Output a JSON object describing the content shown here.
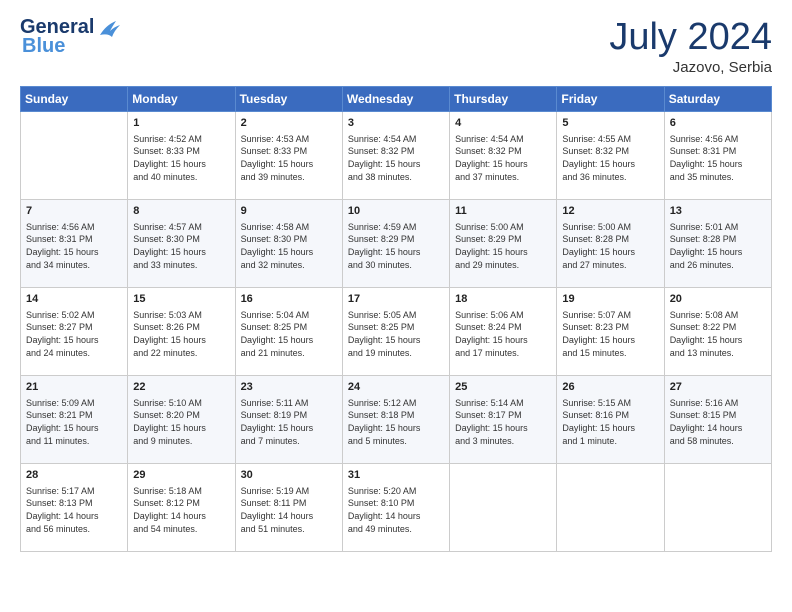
{
  "header": {
    "logo_line1": "General",
    "logo_line2": "Blue",
    "title": "July 2024",
    "location": "Jazovo, Serbia"
  },
  "weekdays": [
    "Sunday",
    "Monday",
    "Tuesday",
    "Wednesday",
    "Thursday",
    "Friday",
    "Saturday"
  ],
  "weeks": [
    [
      {
        "day": "",
        "info": ""
      },
      {
        "day": "1",
        "info": "Sunrise: 4:52 AM\nSunset: 8:33 PM\nDaylight: 15 hours\nand 40 minutes."
      },
      {
        "day": "2",
        "info": "Sunrise: 4:53 AM\nSunset: 8:33 PM\nDaylight: 15 hours\nand 39 minutes."
      },
      {
        "day": "3",
        "info": "Sunrise: 4:54 AM\nSunset: 8:32 PM\nDaylight: 15 hours\nand 38 minutes."
      },
      {
        "day": "4",
        "info": "Sunrise: 4:54 AM\nSunset: 8:32 PM\nDaylight: 15 hours\nand 37 minutes."
      },
      {
        "day": "5",
        "info": "Sunrise: 4:55 AM\nSunset: 8:32 PM\nDaylight: 15 hours\nand 36 minutes."
      },
      {
        "day": "6",
        "info": "Sunrise: 4:56 AM\nSunset: 8:31 PM\nDaylight: 15 hours\nand 35 minutes."
      }
    ],
    [
      {
        "day": "7",
        "info": "Sunrise: 4:56 AM\nSunset: 8:31 PM\nDaylight: 15 hours\nand 34 minutes."
      },
      {
        "day": "8",
        "info": "Sunrise: 4:57 AM\nSunset: 8:30 PM\nDaylight: 15 hours\nand 33 minutes."
      },
      {
        "day": "9",
        "info": "Sunrise: 4:58 AM\nSunset: 8:30 PM\nDaylight: 15 hours\nand 32 minutes."
      },
      {
        "day": "10",
        "info": "Sunrise: 4:59 AM\nSunset: 8:29 PM\nDaylight: 15 hours\nand 30 minutes."
      },
      {
        "day": "11",
        "info": "Sunrise: 5:00 AM\nSunset: 8:29 PM\nDaylight: 15 hours\nand 29 minutes."
      },
      {
        "day": "12",
        "info": "Sunrise: 5:00 AM\nSunset: 8:28 PM\nDaylight: 15 hours\nand 27 minutes."
      },
      {
        "day": "13",
        "info": "Sunrise: 5:01 AM\nSunset: 8:28 PM\nDaylight: 15 hours\nand 26 minutes."
      }
    ],
    [
      {
        "day": "14",
        "info": "Sunrise: 5:02 AM\nSunset: 8:27 PM\nDaylight: 15 hours\nand 24 minutes."
      },
      {
        "day": "15",
        "info": "Sunrise: 5:03 AM\nSunset: 8:26 PM\nDaylight: 15 hours\nand 22 minutes."
      },
      {
        "day": "16",
        "info": "Sunrise: 5:04 AM\nSunset: 8:25 PM\nDaylight: 15 hours\nand 21 minutes."
      },
      {
        "day": "17",
        "info": "Sunrise: 5:05 AM\nSunset: 8:25 PM\nDaylight: 15 hours\nand 19 minutes."
      },
      {
        "day": "18",
        "info": "Sunrise: 5:06 AM\nSunset: 8:24 PM\nDaylight: 15 hours\nand 17 minutes."
      },
      {
        "day": "19",
        "info": "Sunrise: 5:07 AM\nSunset: 8:23 PM\nDaylight: 15 hours\nand 15 minutes."
      },
      {
        "day": "20",
        "info": "Sunrise: 5:08 AM\nSunset: 8:22 PM\nDaylight: 15 hours\nand 13 minutes."
      }
    ],
    [
      {
        "day": "21",
        "info": "Sunrise: 5:09 AM\nSunset: 8:21 PM\nDaylight: 15 hours\nand 11 minutes."
      },
      {
        "day": "22",
        "info": "Sunrise: 5:10 AM\nSunset: 8:20 PM\nDaylight: 15 hours\nand 9 minutes."
      },
      {
        "day": "23",
        "info": "Sunrise: 5:11 AM\nSunset: 8:19 PM\nDaylight: 15 hours\nand 7 minutes."
      },
      {
        "day": "24",
        "info": "Sunrise: 5:12 AM\nSunset: 8:18 PM\nDaylight: 15 hours\nand 5 minutes."
      },
      {
        "day": "25",
        "info": "Sunrise: 5:14 AM\nSunset: 8:17 PM\nDaylight: 15 hours\nand 3 minutes."
      },
      {
        "day": "26",
        "info": "Sunrise: 5:15 AM\nSunset: 8:16 PM\nDaylight: 15 hours\nand 1 minute."
      },
      {
        "day": "27",
        "info": "Sunrise: 5:16 AM\nSunset: 8:15 PM\nDaylight: 14 hours\nand 58 minutes."
      }
    ],
    [
      {
        "day": "28",
        "info": "Sunrise: 5:17 AM\nSunset: 8:13 PM\nDaylight: 14 hours\nand 56 minutes."
      },
      {
        "day": "29",
        "info": "Sunrise: 5:18 AM\nSunset: 8:12 PM\nDaylight: 14 hours\nand 54 minutes."
      },
      {
        "day": "30",
        "info": "Sunrise: 5:19 AM\nSunset: 8:11 PM\nDaylight: 14 hours\nand 51 minutes."
      },
      {
        "day": "31",
        "info": "Sunrise: 5:20 AM\nSunset: 8:10 PM\nDaylight: 14 hours\nand 49 minutes."
      },
      {
        "day": "",
        "info": ""
      },
      {
        "day": "",
        "info": ""
      },
      {
        "day": "",
        "info": ""
      }
    ]
  ]
}
